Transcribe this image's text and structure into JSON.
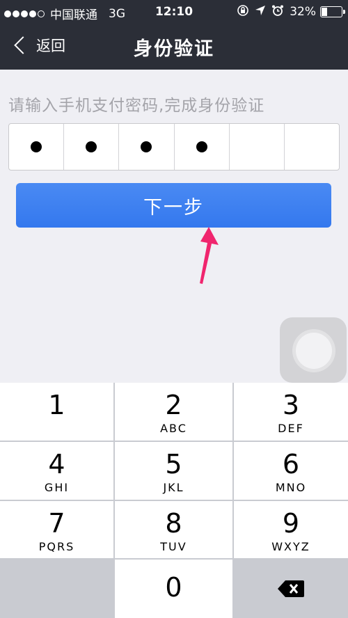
{
  "status_bar": {
    "carrier": "中国联通",
    "network": "3G",
    "time": "12:10",
    "battery": "32%",
    "battery_level": 0.32
  },
  "nav": {
    "back_label": "返回",
    "title": "身份验证"
  },
  "prompt": "请输入手机支付密码,完成身份验证",
  "pin": {
    "length": 6,
    "filled": 4
  },
  "next_button_label": "下一步",
  "keypad": [
    {
      "num": "1",
      "letters": ""
    },
    {
      "num": "2",
      "letters": "ABC"
    },
    {
      "num": "3",
      "letters": "DEF"
    },
    {
      "num": "4",
      "letters": "GHI"
    },
    {
      "num": "5",
      "letters": "JKL"
    },
    {
      "num": "6",
      "letters": "MNO"
    },
    {
      "num": "7",
      "letters": "PQRS"
    },
    {
      "num": "8",
      "letters": "TUV"
    },
    {
      "num": "9",
      "letters": "WXYZ"
    },
    {
      "num": "0",
      "letters": ""
    }
  ],
  "colors": {
    "nav_bg": "#2b2e37",
    "page_bg": "#efeff4",
    "button_blue": "#3a7ff0",
    "arrow_pink": "#f0256e"
  },
  "icons": {
    "back": "chevron-left-icon",
    "delete": "backspace-icon",
    "arrow": "pointer-arrow-icon"
  }
}
